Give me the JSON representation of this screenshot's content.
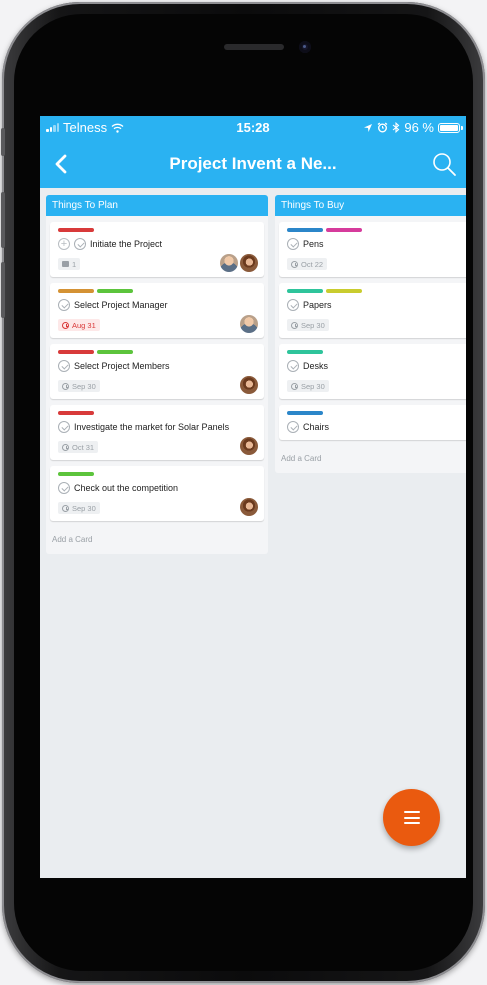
{
  "status": {
    "carrier": "Telness",
    "time": "15:28",
    "battery": "96 %"
  },
  "appbar": {
    "title": "Project Invent a Ne..."
  },
  "lists": [
    {
      "title": "Things To Plan",
      "add_label": "Add a Card",
      "cards": [
        {
          "title": "Initiate the Project",
          "labels": [
            "#d83a3a"
          ],
          "badge": "1"
        },
        {
          "title": "Select Project Manager",
          "labels": [
            "#d49234",
            "#5cc43c"
          ],
          "badge": "Aug 31"
        },
        {
          "title": "Select Project Members",
          "labels": [
            "#d83a3a",
            "#5cc43c"
          ],
          "badge": "Sep 30"
        },
        {
          "title": "Investigate the market for Solar Panels",
          "labels": [
            "#d83a3a"
          ],
          "badge": "Oct 31"
        },
        {
          "title": "Check out the competition",
          "labels": [
            "#5cc43c"
          ],
          "badge": "Sep 30"
        }
      ]
    },
    {
      "title": "Things To Buy",
      "add_label": "Add a Card",
      "cards": [
        {
          "title": "Pens",
          "labels": [
            "#2b86c9",
            "#d63b9c"
          ],
          "badge": "Oct 22"
        },
        {
          "title": "Papers",
          "labels": [
            "#2ec49b",
            "#c9cc2e"
          ],
          "badge": "Sep 30"
        },
        {
          "title": "Desks",
          "labels": [
            "#2ec49b"
          ],
          "badge": "Sep 30"
        },
        {
          "title": "Chairs",
          "labels": [
            "#2b86c9"
          ]
        }
      ]
    }
  ],
  "colors": {
    "accent": "#2ab2f2",
    "fab": "#ea5a0f",
    "due": "#d93838"
  },
  "icons": {
    "back": "chevron-left-icon",
    "search": "search-icon",
    "fab": "menu-icon"
  }
}
